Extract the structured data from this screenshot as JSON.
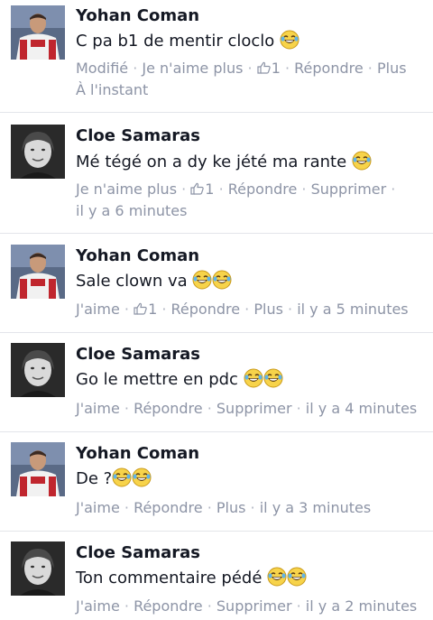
{
  "comments": [
    {
      "author": "Yohan Coman",
      "avatar": "yohan-avatar",
      "text": "C pa b1 de mentir cloclo",
      "emoji_count": 1,
      "actions": [
        "Modifié",
        "Je n'aime plus",
        "1",
        "Répondre",
        "Plus"
      ],
      "time": "À l'instant"
    },
    {
      "author": "Cloe Samaras",
      "avatar": "cloe-avatar",
      "text": "Mé tégé on a dy ke jété ma rante",
      "emoji_count": 1,
      "actions": [
        "Je n'aime plus",
        "1",
        "Répondre",
        "Supprimer"
      ],
      "time": "il y a 6 minutes"
    },
    {
      "author": "Yohan Coman",
      "avatar": "yohan-avatar",
      "text": "Sale clown va",
      "emoji_count": 2,
      "actions": [
        "J'aime",
        "1",
        "Répondre",
        "Plus"
      ],
      "time": "il y a 5 minutes"
    },
    {
      "author": "Cloe Samaras",
      "avatar": "cloe-avatar",
      "text": "Go le mettre en pdc",
      "emoji_count": 2,
      "actions": [
        "J'aime",
        "Répondre",
        "Supprimer"
      ],
      "time": "il y a 4 minutes"
    },
    {
      "author": "Yohan Coman",
      "avatar": "yohan-avatar",
      "text": "De ?",
      "emoji_count": 2,
      "actions": [
        "J'aime",
        "Répondre",
        "Plus"
      ],
      "time": "il y a 3 minutes"
    },
    {
      "author": "Cloe Samaras",
      "avatar": "cloe-avatar",
      "text": "Ton commentaire pédé",
      "emoji_count": 2,
      "actions": [
        "J'aime",
        "Répondre",
        "Supprimer"
      ],
      "time": "il y a 2 minutes"
    }
  ],
  "colors": {
    "name": "#141823",
    "meta": "#8d94a6",
    "divider": "#e3e5ea"
  }
}
